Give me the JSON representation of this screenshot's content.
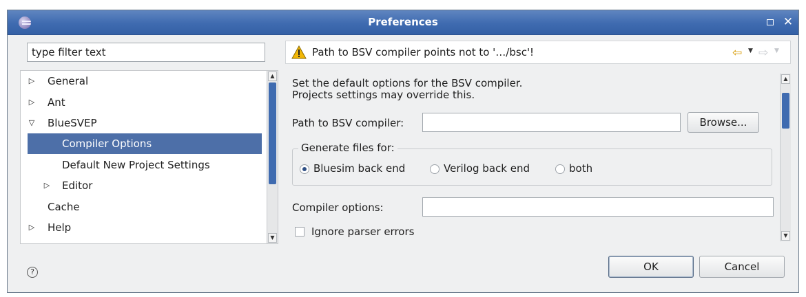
{
  "window": {
    "title": "Preferences",
    "maximize_icon": "maximize-icon",
    "close_icon": "close-icon",
    "close_glyph": "✕"
  },
  "filter": {
    "placeholder": "type filter text"
  },
  "tree": {
    "items": [
      {
        "label": "General",
        "expander": "collapsed"
      },
      {
        "label": "Ant",
        "expander": "collapsed"
      },
      {
        "label": "BlueSVEP",
        "expander": "expanded"
      },
      {
        "label": "Compiler Options",
        "selected": true
      },
      {
        "label": "Default New Project Settings"
      },
      {
        "label": "Editor",
        "expander": "collapsed"
      },
      {
        "label": "Cache"
      },
      {
        "label": "Help",
        "expander": "collapsed"
      }
    ]
  },
  "message": {
    "icon": "warning-icon",
    "text": "Path to BSV compiler points not to '…/bsc'!"
  },
  "page": {
    "description_line1": "Set the default options for the BSV compiler.",
    "description_line2": "Projects settings may override this.",
    "path_label": "Path to BSV compiler:",
    "path_value": "",
    "browse_label": "Browse...",
    "group_title": "Generate files for:",
    "radio_options": [
      {
        "label": "Bluesim back end",
        "checked": true
      },
      {
        "label": "Verilog back end",
        "checked": false
      },
      {
        "label": "both",
        "checked": false
      }
    ],
    "compiler_options_label": "Compiler options:",
    "compiler_options_value": "",
    "ignore_errors_label": "Ignore parser errors",
    "ignore_errors_checked": false
  },
  "footer": {
    "help_icon": "help-icon",
    "help_glyph": "?",
    "ok_label": "OK",
    "cancel_label": "Cancel"
  },
  "colors": {
    "titlebar": "#3f6bb0",
    "selection": "#4d6fa8",
    "warning": "#f2b705"
  }
}
